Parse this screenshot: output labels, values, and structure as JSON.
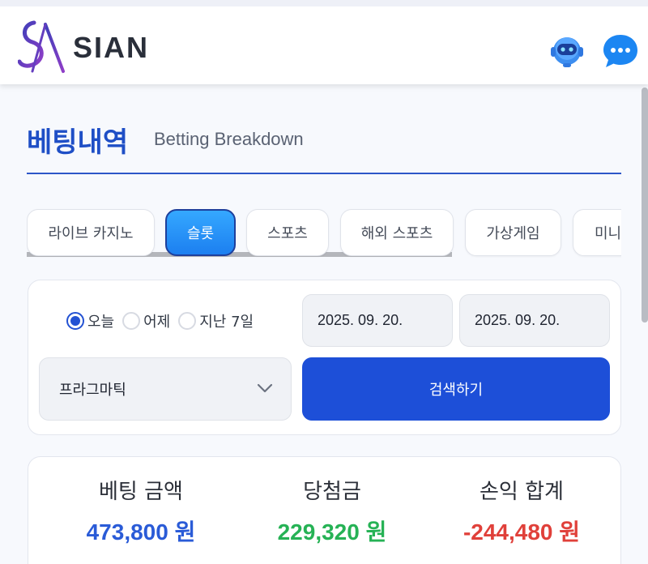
{
  "header": {
    "brand": "SIAN"
  },
  "page": {
    "title_ko": "베팅내역",
    "title_en": "Betting Breakdown"
  },
  "tabs": [
    {
      "label": "라이브 카지노"
    },
    {
      "label": "슬롯"
    },
    {
      "label": "스포츠"
    },
    {
      "label": "해외 스포츠"
    },
    {
      "label": "가상게임"
    },
    {
      "label": "미니"
    }
  ],
  "active_tab": "슬롯",
  "filter": {
    "period_options": [
      {
        "label": "오늘",
        "selected": true
      },
      {
        "label": "어제",
        "selected": false
      },
      {
        "label": "지난 7일",
        "selected": false
      }
    ],
    "start_date": "2025. 09. 20.",
    "end_date": "2025. 09. 20.",
    "provider": "프라그마틱",
    "search_label": "검색하기"
  },
  "summary": {
    "bet_amount_label": "베팅 금액",
    "bet_amount_value": "473,800 원",
    "win_amount_label": "당첨금",
    "win_amount_value": "229,320 원",
    "profit_label": "손익 합계",
    "profit_value": "-244,480 원"
  },
  "colors": {
    "accent": "#1d4fd8",
    "bet_value": "#2a5bd7",
    "win_value": "#26b255",
    "profit_value": "#e0403a"
  },
  "icons": [
    "sian-logo-icon",
    "bot-assistant-icon",
    "chat-bubble-icon",
    "chevron-down-icon"
  ]
}
